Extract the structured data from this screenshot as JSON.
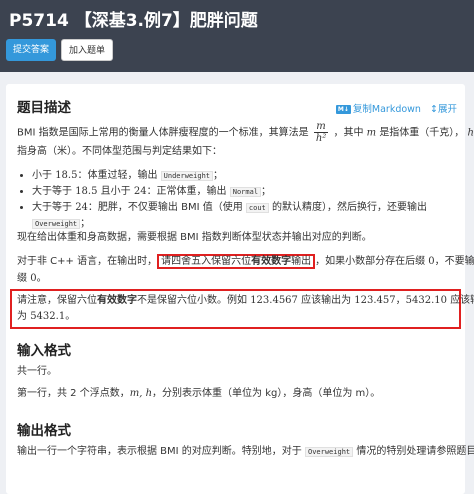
{
  "header": {
    "title": "P5714 【深基3.例7】肥胖问题",
    "submit_label": "提交答案",
    "add_label": "加入题单"
  },
  "description": {
    "heading": "题目描述",
    "copy_label": "复制Markdown",
    "expand_label": "展开",
    "intro_1": "BMI 指数是国际上常用的衡量人体胖瘦程度的一个标准，其算法是",
    "frac_num": "m",
    "frac_den": "h²",
    "intro_2": "，其中",
    "var_m": "m",
    "intro_3": "是指体重（千克），",
    "var_h": "h",
    "intro_4": "是",
    "intro_line2": "指身高（米）。不同体型范围与判定结果如下：",
    "rule1_pre": "小于",
    "rule1_num": "18.5",
    "rule1_post": "：体重过轻，输出",
    "rule1_code": "Underweight",
    "rule1_end": "；",
    "rule2_pre": "大于等于",
    "rule2_num1": "18.5",
    "rule2_mid": "且小于",
    "rule2_num2": "24",
    "rule2_post": "：正常体重，输出",
    "rule2_code": "Normal",
    "rule2_end": "；",
    "rule3_pre": "大于等于",
    "rule3_num": "24",
    "rule3_post": "：肥胖，不仅要输出 BMI 值（使用",
    "rule3_code": "cout",
    "rule3_post2": "的默认精度），然后换行，还要输出",
    "rule3_code2": "Overweight",
    "rule3_end": "；",
    "para_given": "现在给出体重和身高数据，需要根据 BMI 指数判断体型状态并输出对应的判断。",
    "cpp_1": "对于非 C++ 语言，在输出时，",
    "cpp_highlight_1": "请四舍五入保留六位",
    "cpp_highlight_bold": "有效数字",
    "cpp_highlight_2": "输出",
    "cpp_2": "，如果小数部分存在后缀",
    "cpp_zero": "0",
    "cpp_3": "，不要输出后",
    "cpp_line2_1": "缀",
    "cpp_line2_zero": "0",
    "cpp_line2_2": "。",
    "note_1": "请注意，保留六位",
    "note_bold": "有效数字",
    "note_2": "不是保留六位小数。例如",
    "note_num1": "123.4567",
    "note_3": "应该输出为",
    "note_num2": "123.457",
    "note_4": "，",
    "note_num3": "5432.10",
    "note_5": "应该输出",
    "note_line2_1": "为",
    "note_num4": "5432.1",
    "note_line2_2": "。"
  },
  "input": {
    "heading": "输入格式",
    "line1": "共一行。",
    "line2_1": "第一行，共 2 个浮点数，",
    "line2_vars": "m, h",
    "line2_2": "，分别表示体重（单位为 kg），身高（单位为 m）。"
  },
  "output": {
    "heading": "输出格式",
    "line1_1": "输出一行一个字符串，表示根据 BMI 的对应判断。特别地，对于",
    "line1_code": "Overweight",
    "line1_2": "情况的特别处理请参照题目"
  }
}
